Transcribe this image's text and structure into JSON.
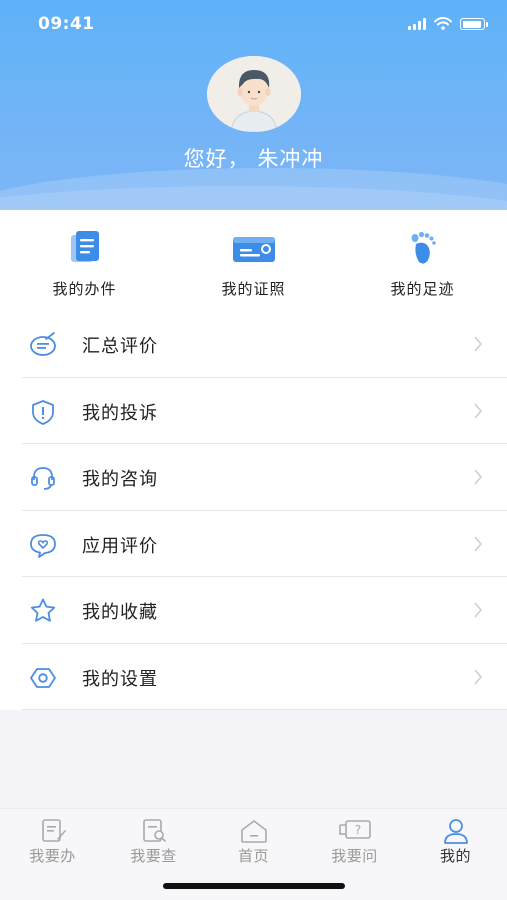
{
  "status_bar": {
    "time": "09:41"
  },
  "profile": {
    "greeting": "您好， 朱冲冲"
  },
  "quick_actions": [
    {
      "label": "我的办件",
      "icon": "document-stack-icon"
    },
    {
      "label": "我的证照",
      "icon": "id-card-icon"
    },
    {
      "label": "我的足迹",
      "icon": "footprint-icon"
    }
  ],
  "menu": [
    {
      "label": "汇总评价",
      "icon": "rating-summary-icon"
    },
    {
      "label": "我的投诉",
      "icon": "complaint-shield-icon"
    },
    {
      "label": "我的咨询",
      "icon": "headset-icon"
    },
    {
      "label": "应用评价",
      "icon": "heart-chat-icon"
    },
    {
      "label": "我的收藏",
      "icon": "star-icon"
    },
    {
      "label": "我的设置",
      "icon": "settings-hexagon-icon"
    }
  ],
  "tabs": [
    {
      "label": "我要办",
      "icon": "edit-doc-icon"
    },
    {
      "label": "我要查",
      "icon": "search-doc-icon"
    },
    {
      "label": "首页",
      "icon": "home-icon"
    },
    {
      "label": "我要问",
      "icon": "question-chat-icon"
    },
    {
      "label": "我的",
      "icon": "user-icon",
      "active": true
    }
  ],
  "colors": {
    "accent": "#5aa7f2",
    "header_top": "#5fb2f8",
    "header_bottom": "#7fb6f6",
    "icon_blue": "#4d8ee0"
  }
}
